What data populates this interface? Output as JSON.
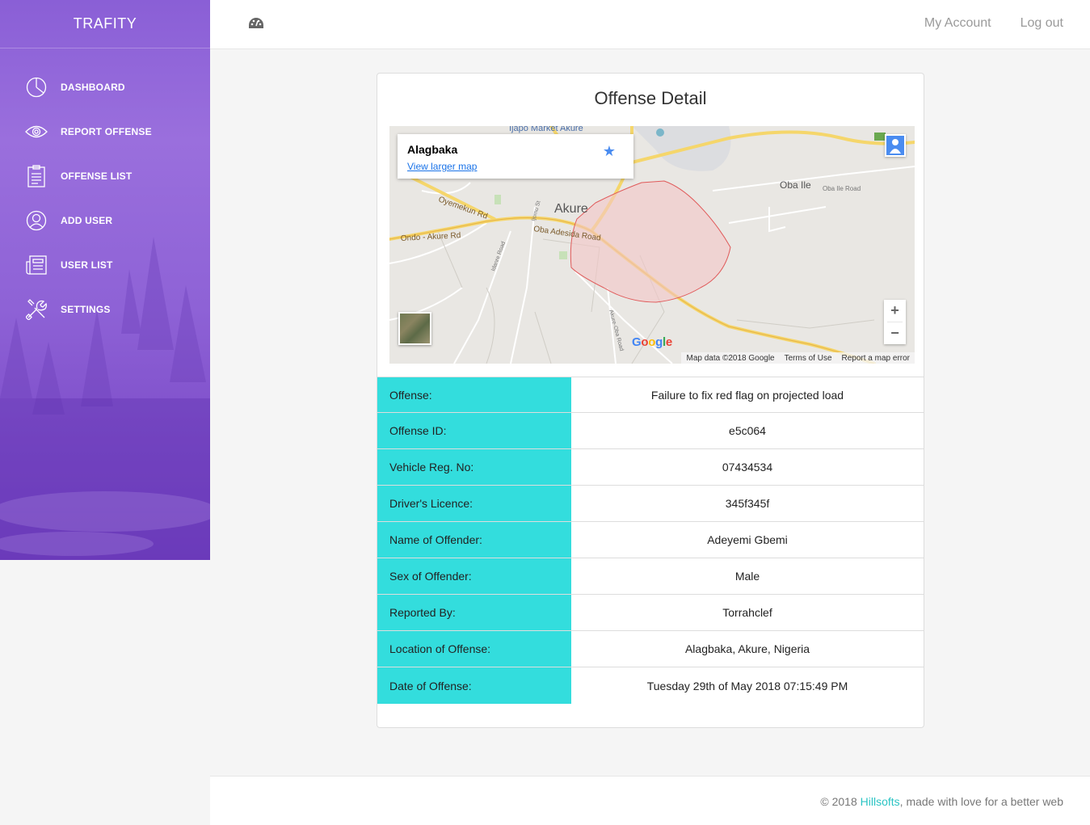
{
  "brand": "TRAFITY",
  "sidebar": {
    "items": [
      {
        "label": "DASHBOARD",
        "icon": "pie-chart-icon"
      },
      {
        "label": "REPORT OFFENSE",
        "icon": "eye-icon"
      },
      {
        "label": "OFFENSE LIST",
        "icon": "clipboard-icon"
      },
      {
        "label": "ADD USER",
        "icon": "user-icon"
      },
      {
        "label": "USER LIST",
        "icon": "news-list-icon"
      },
      {
        "label": "SETTINGS",
        "icon": "tools-icon"
      }
    ]
  },
  "topbar": {
    "icon": "dashboard-gauge-icon",
    "my_account": "My Account",
    "logout": "Log out"
  },
  "card": {
    "title": "Offense Detail"
  },
  "map": {
    "place_name": "Alagbaka",
    "view_larger": "View larger map",
    "labels": {
      "city": "Akure",
      "oba_ile": "Oba Ile",
      "oba_ile_road": "Oba Ile Road",
      "oba_adesida_road": "Oba Adesida Road",
      "oyemekun_rd": "Oyemekun Rd",
      "ondo_akure_rd": "Ondo - Akure Rd",
      "ijapo_market": "Ijapo Market Akure",
      "idanre_road": "Idanre Road",
      "akure_oba_road": "Akure-Oba Road",
      "ijomu_st": "Ijomu St"
    },
    "zoom_in": "+",
    "zoom_out": "−",
    "attribution": [
      "Map data ©2018 Google",
      "Terms of Use",
      "Report a map error"
    ],
    "google": "Google"
  },
  "details": [
    {
      "label": "Offense:",
      "value": "Failure to fix red flag on projected load"
    },
    {
      "label": "Offense ID:",
      "value": "e5c064"
    },
    {
      "label": "Vehicle Reg. No:",
      "value": "07434534"
    },
    {
      "label": "Driver's Licence:",
      "value": "345f345f"
    },
    {
      "label": "Name of Offender:",
      "value": "Adeyemi Gbemi"
    },
    {
      "label": "Sex of Offender:",
      "value": "Male"
    },
    {
      "label": "Reported By:",
      "value": "Torrahclef"
    },
    {
      "label": "Location of Offense:",
      "value": "Alagbaka, Akure, Nigeria"
    },
    {
      "label": "Date of Offense:",
      "value": "Tuesday 29th of May 2018 07:15:49 PM"
    }
  ],
  "footer": {
    "prefix": "© 2018 ",
    "link": "Hillsofts",
    "suffix": ", made with love for a better web"
  },
  "colors": {
    "sidebar_accent": "#8a5fd6",
    "label_cell": "#33dddd",
    "footer_link": "#2bc4c4"
  }
}
